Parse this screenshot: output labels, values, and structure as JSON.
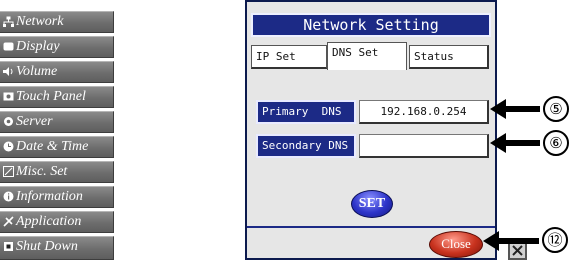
{
  "sidebar": {
    "items": [
      {
        "label": "Network",
        "icon": "network-icon"
      },
      {
        "label": "Display",
        "icon": "display-icon"
      },
      {
        "label": "Volume",
        "icon": "speaker-icon"
      },
      {
        "label": "Touch Panel",
        "icon": "touch-panel-icon"
      },
      {
        "label": "Server",
        "icon": "server-icon"
      },
      {
        "label": "Date & Time",
        "icon": "clock-icon"
      },
      {
        "label": "Misc. Set",
        "icon": "misc-icon"
      },
      {
        "label": "Information",
        "icon": "info-icon"
      },
      {
        "label": "Application",
        "icon": "application-icon"
      },
      {
        "label": "Shut Down",
        "icon": "shutdown-icon"
      }
    ]
  },
  "panel": {
    "title": "Network Setting",
    "tabs": [
      {
        "label": "IP Set",
        "active": false
      },
      {
        "label": "DNS Set",
        "active": true
      },
      {
        "label": "Status",
        "active": false
      }
    ],
    "primary_dns": {
      "label": "Primary  DNS",
      "value": "192.168.0.254"
    },
    "secondary_dns": {
      "label": "Secondary DNS",
      "value": ""
    },
    "set_label": "SET",
    "close_label": "Close"
  },
  "callouts": {
    "primary": "⑤",
    "secondary": "⑥",
    "close": "⑫"
  },
  "colors": {
    "panel_blue": "#1c2a86",
    "sidebar_gray": "#6d6d6d",
    "close_red": "#c8321e"
  }
}
